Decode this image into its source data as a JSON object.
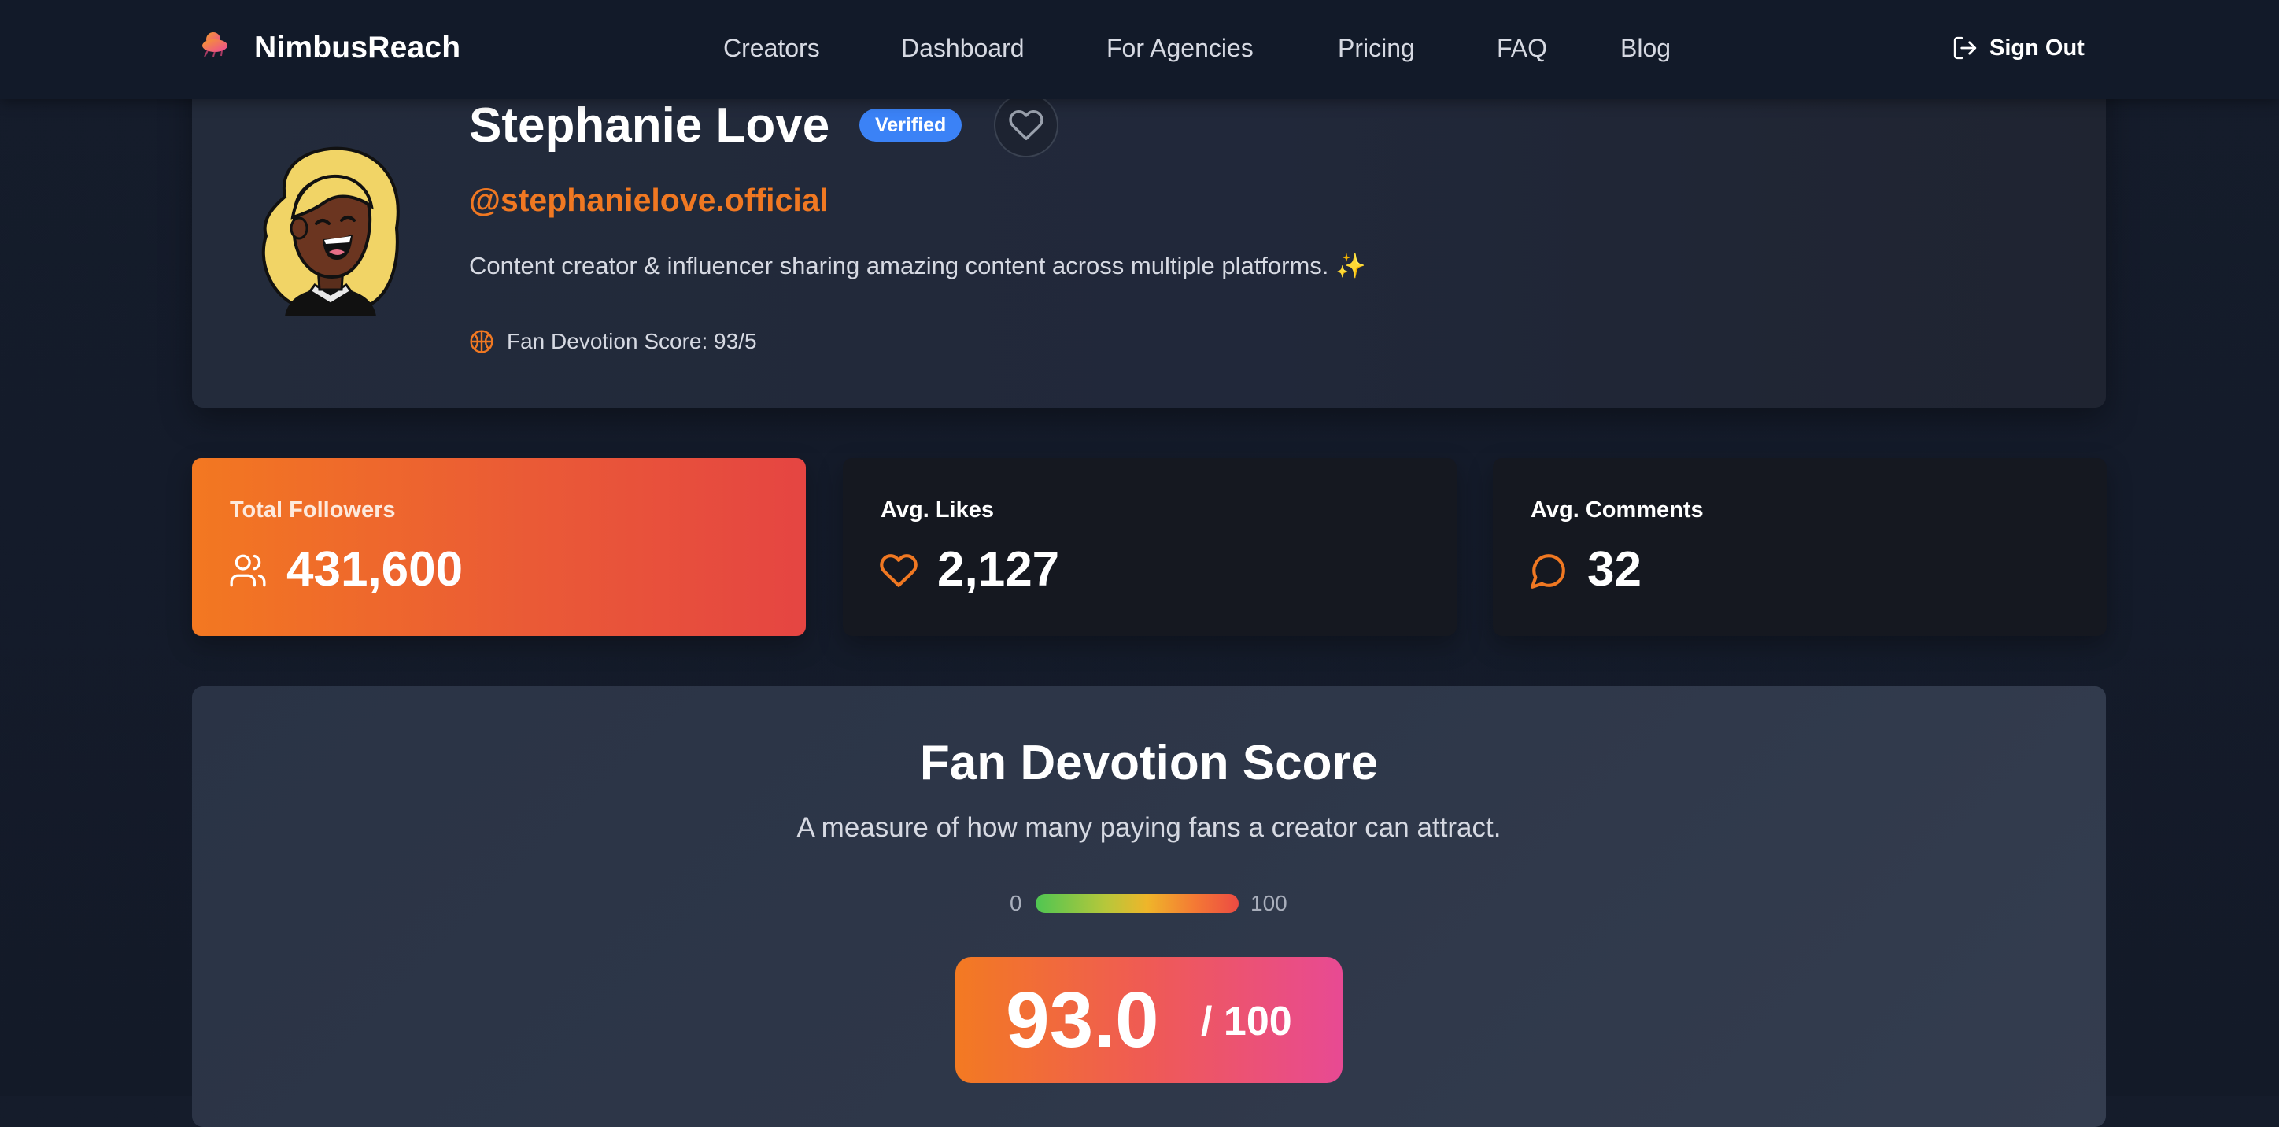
{
  "brand": {
    "name": "NimbusReach"
  },
  "nav": {
    "links": [
      "Creators",
      "Dashboard",
      "For Agencies",
      "Pricing",
      "FAQ",
      "Blog"
    ],
    "sign_out": "Sign Out"
  },
  "profile": {
    "name": "Stephanie Love",
    "badge": "Verified",
    "handle": "@stephanielove.official",
    "bio": "Content creator & influencer sharing amazing content across multiple platforms. ✨",
    "fan_score_line": "Fan Devotion Score: 93/5"
  },
  "stats": [
    {
      "label": "Total Followers",
      "value": "431,600",
      "icon": "users-icon"
    },
    {
      "label": "Avg. Likes",
      "value": "2,127",
      "icon": "heart-icon"
    },
    {
      "label": "Avg. Comments",
      "value": "32",
      "icon": "comment-icon"
    }
  ],
  "fan_devotion": {
    "title": "Fan Devotion Score",
    "subtitle": "A measure of how many paying fans a creator can attract.",
    "scale_min": "0",
    "scale_max": "100",
    "score": "93.0",
    "score_suffix": "/ 100"
  },
  "colors": {
    "accent_orange": "#f07822",
    "verified_blue": "#3b82f6",
    "background": "#141b2a"
  }
}
